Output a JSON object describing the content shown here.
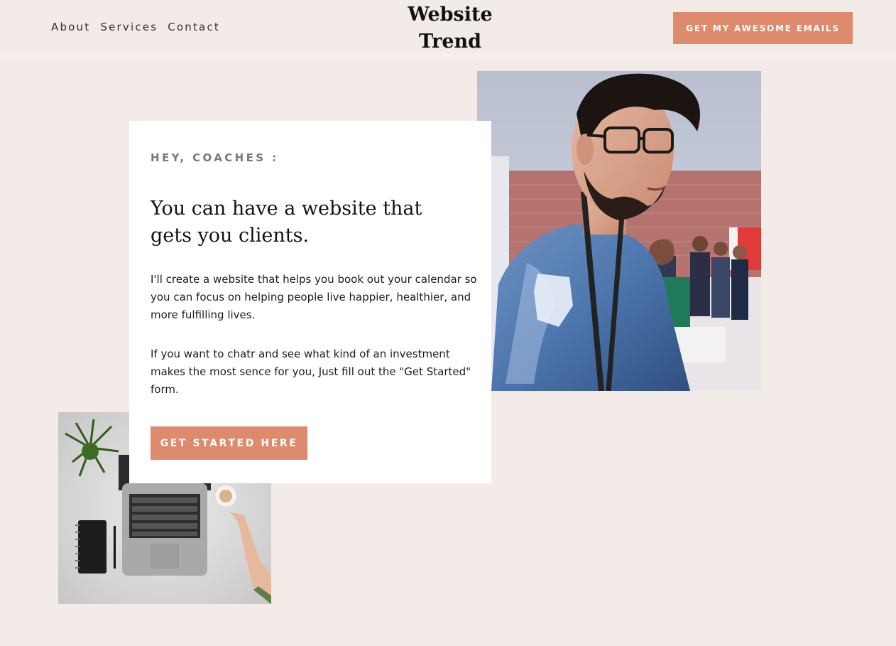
{
  "header": {
    "nav": [
      "About",
      "Services",
      "Contact"
    ],
    "brand_line1": "Website",
    "brand_line2": "Trend",
    "cta_label": "GET MY AWESOME EMAILS"
  },
  "hero": {
    "eyebrow": "HEY, COACHES :",
    "headline": "You can have a website that gets you clients.",
    "paragraph1": "I'll create a website that helps you book out your calendar so you can focus on helping people live happier, healthier, and more fulfilling lives.",
    "paragraph2": "If you want to chatr and see what kind of an investment makes the most sence for you, Just fill out the \"Get Started\" form.",
    "cta_label": "GET STARTED HERE"
  },
  "colors": {
    "background": "#f3ebe8",
    "accent": "#de8a6c",
    "card": "#ffffff"
  },
  "images": {
    "portrait": "portrait-photo",
    "desk": "laptop-desk-photo"
  }
}
